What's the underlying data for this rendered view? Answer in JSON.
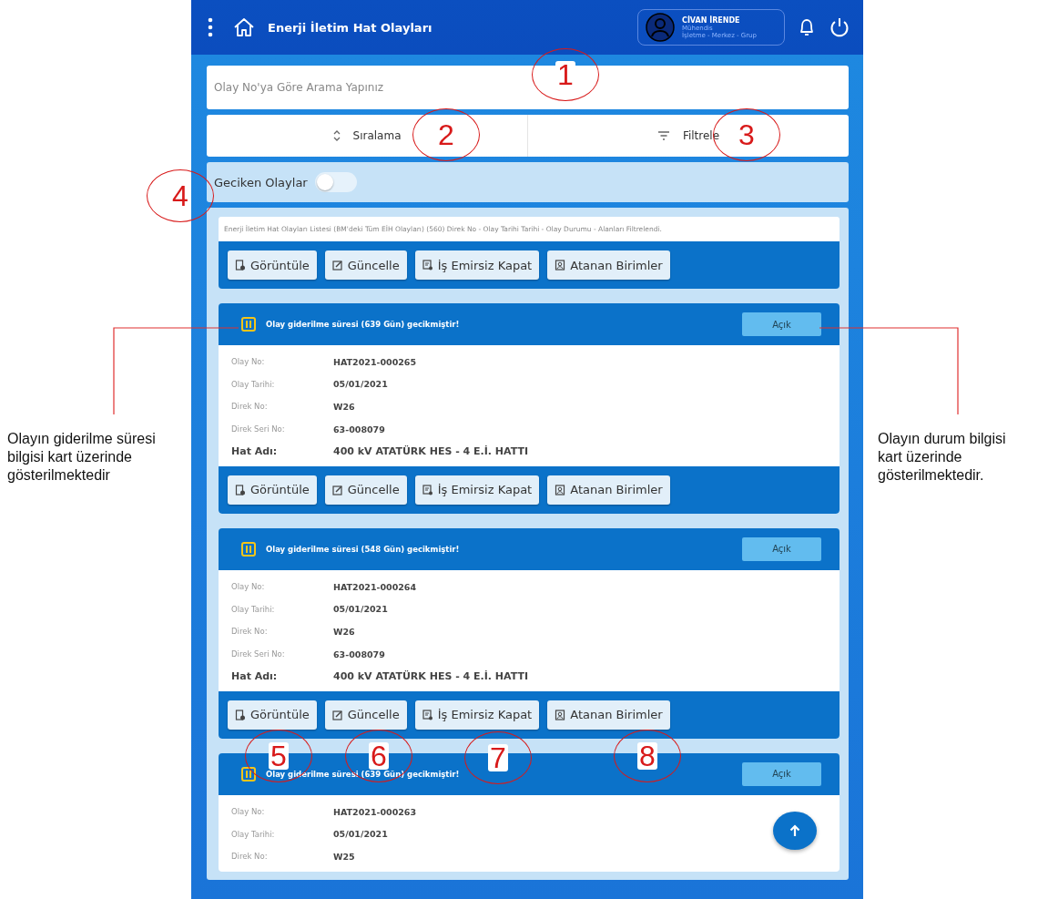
{
  "header": {
    "title": "Enerji İletim Hat Olayları",
    "user": {
      "name": "CİVAN İRENDE",
      "role": "Mühendis",
      "unit": "İşletme - Merkez - Grup"
    }
  },
  "search": {
    "placeholder": "Olay No'ya Göre Arama Yapınız"
  },
  "sort_label": "Sıralama",
  "filter_label": "Filtrele",
  "delayed_toggle": {
    "label": "Geciken Olaylar",
    "on": false
  },
  "list": {
    "summary": "Enerji İletim Hat Olayları Listesi (BM'deki Tüm EİH Olayları) (560) Direk No - Olay Tarihi Tarihi - Olay Durumu - Alanları Filtrelendi.",
    "actions": [
      "Görüntüle",
      "Güncelle",
      "İş Emirsiz Kapat",
      "Atanan Birimler"
    ],
    "cards": [
      {
        "alert": "Olay giderilme süresi (639 Gün) gecikmiştir!",
        "status": "Açık",
        "fields": [
          {
            "label": "Olay No:",
            "value": "HAT2021-000265",
            "kind": "plain"
          },
          {
            "label": "Olay Tarihi:",
            "value": "05/01/2021",
            "kind": "plain"
          },
          {
            "label": "Direk No:",
            "value": "W26",
            "kind": "plain"
          },
          {
            "label": "Direk Seri No:",
            "value": "63-008079",
            "kind": "plain"
          },
          {
            "label": "Hat Adı:",
            "value": "400 kV ATATÜRK HES - 4 E.İ. HATTI",
            "kind": "title"
          }
        ],
        "actions": [
          "Görüntüle",
          "Güncelle",
          "İş Emirsiz Kapat",
          "Atanan Birimler"
        ]
      },
      {
        "alert": "Olay giderilme süresi (548 Gün) gecikmiştir!",
        "status": "Açık",
        "fields": [
          {
            "label": "Olay No:",
            "value": "HAT2021-000264",
            "kind": "plain"
          },
          {
            "label": "Olay Tarihi:",
            "value": "05/01/2021",
            "kind": "plain"
          },
          {
            "label": "Direk No:",
            "value": "W26",
            "kind": "plain"
          },
          {
            "label": "Direk Seri No:",
            "value": "63-008079",
            "kind": "plain"
          },
          {
            "label": "Hat Adı:",
            "value": "400 kV ATATÜRK HES - 4 E.İ. HATTI",
            "kind": "title"
          }
        ],
        "actions": [
          "Görüntüle",
          "Güncelle",
          "İş Emirsiz Kapat",
          "Atanan Birimler"
        ]
      },
      {
        "alert": "Olay giderilme süresi (639 Gün) gecikmiştir!",
        "status": "Açık",
        "fields": [
          {
            "label": "Olay No:",
            "value": "HAT2021-000263",
            "kind": "plain"
          },
          {
            "label": "Olay Tarihi:",
            "value": "05/01/2021",
            "kind": "plain"
          },
          {
            "label": "Direk No:",
            "value": "W25",
            "kind": "plain"
          }
        ]
      }
    ]
  },
  "annotations": {
    "markers": [
      "1",
      "2",
      "3",
      "4",
      "5",
      "6",
      "7",
      "8"
    ],
    "notes": [
      {
        "text": "Olayın giderilme süresi bilgisi kart üzerinde gösterilmektedir"
      },
      {
        "text": "Olayın durum bilgisi kart üzerinde gösterilmektedir."
      }
    ]
  }
}
